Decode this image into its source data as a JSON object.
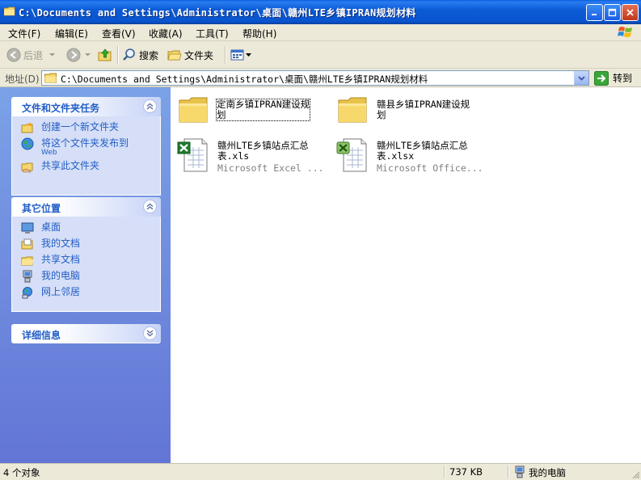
{
  "window": {
    "title": "C:\\Documents and Settings\\Administrator\\桌面\\赣州LTE乡镇IPRAN规划材料",
    "caption_buttons": [
      "minimize-icon",
      "maximize-icon",
      "close-icon"
    ]
  },
  "menu": {
    "items": [
      "文件(F)",
      "编辑(E)",
      "查看(V)",
      "收藏(A)",
      "工具(T)",
      "帮助(H)"
    ]
  },
  "toolbar": {
    "back_label": "后退",
    "search_label": "搜索",
    "folders_label": "文件夹"
  },
  "address": {
    "label": "地址(D)",
    "value": "C:\\Documents and Settings\\Administrator\\桌面\\赣州LTE乡镇IPRAN规划材料",
    "go_label": "转到"
  },
  "tasks_panel": {
    "title": "文件和文件夹任务",
    "items": [
      {
        "label": "创建一个新文件夹",
        "icon": "new-folder-icon"
      },
      {
        "label": "将这个文件夹发布到",
        "sub": "Web",
        "icon": "publish-web-icon"
      },
      {
        "label": "共享此文件夹",
        "icon": "share-folder-icon"
      }
    ]
  },
  "places_panel": {
    "title": "其它位置",
    "items": [
      {
        "label": "桌面",
        "icon": "desktop-icon"
      },
      {
        "label": "我的文档",
        "icon": "my-documents-icon"
      },
      {
        "label": "共享文档",
        "icon": "shared-documents-icon"
      },
      {
        "label": "我的电脑",
        "icon": "my-computer-icon"
      },
      {
        "label": "网上邻居",
        "icon": "network-places-icon"
      }
    ]
  },
  "details_panel": {
    "title": "详细信息"
  },
  "files": [
    {
      "name_line1": "定南乡镇IPRAN建设规",
      "name_line2": "划",
      "type": "",
      "icon": "folder-icon"
    },
    {
      "name_line1": "赣县乡镇IPRAN建设规",
      "name_line2": "划",
      "type": "",
      "icon": "folder-icon"
    },
    {
      "name_line1": "赣州LTE乡镇站点汇总",
      "name_line2": "表.xls",
      "type": "Microsoft Excel ...",
      "icon": "excel-xls-icon"
    },
    {
      "name_line1": "赣州LTE乡镇站点汇总",
      "name_line2": "表.xlsx",
      "type": "Microsoft Office...",
      "icon": "excel-xlsx-icon"
    }
  ],
  "status": {
    "objects": "4 个对象",
    "size": "737 KB",
    "location": "我的电脑"
  }
}
